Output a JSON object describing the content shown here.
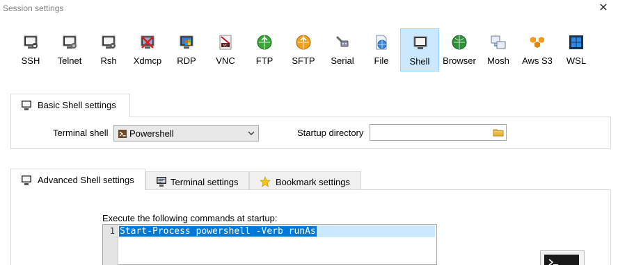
{
  "window": {
    "title": "Session settings",
    "close_symbol": "✕"
  },
  "session_types": [
    {
      "label": "SSH",
      "icon": "ssh-icon"
    },
    {
      "label": "Telnet",
      "icon": "telnet-icon"
    },
    {
      "label": "Rsh",
      "icon": "rsh-icon"
    },
    {
      "label": "Xdmcp",
      "icon": "xdmcp-icon"
    },
    {
      "label": "RDP",
      "icon": "rdp-icon"
    },
    {
      "label": "VNC",
      "icon": "vnc-icon"
    },
    {
      "label": "FTP",
      "icon": "ftp-icon"
    },
    {
      "label": "SFTP",
      "icon": "sftp-icon"
    },
    {
      "label": "Serial",
      "icon": "serial-icon"
    },
    {
      "label": "File",
      "icon": "file-icon"
    },
    {
      "label": "Shell",
      "icon": "shell-icon",
      "selected": true
    },
    {
      "label": "Browser",
      "icon": "browser-icon"
    },
    {
      "label": "Mosh",
      "icon": "mosh-icon"
    },
    {
      "label": "Aws S3",
      "icon": "aws-s3-icon"
    },
    {
      "label": "WSL",
      "icon": "wsl-icon"
    }
  ],
  "basic": {
    "tab_label": "Basic Shell settings",
    "terminal_shell_label": "Terminal shell",
    "terminal_shell_value": "Powershell",
    "startup_directory_label": "Startup directory",
    "startup_directory_value": ""
  },
  "advanced": {
    "tabs": [
      {
        "label": "Advanced Shell settings",
        "active": true,
        "icon": "terminal-icon"
      },
      {
        "label": "Terminal settings",
        "active": false,
        "icon": "terminal-settings-icon"
      },
      {
        "label": "Bookmark settings",
        "active": false,
        "icon": "star-icon"
      }
    ],
    "commands_label": "Execute the following commands at startup:",
    "lines": [
      {
        "number": "1",
        "text": "Start-Process powershell -Verb runAs"
      }
    ]
  },
  "colors": {
    "selection_bg": "#0078d7",
    "selected_tool_bg": "#cce8ff",
    "current_line_bg": "#cce8ff"
  }
}
